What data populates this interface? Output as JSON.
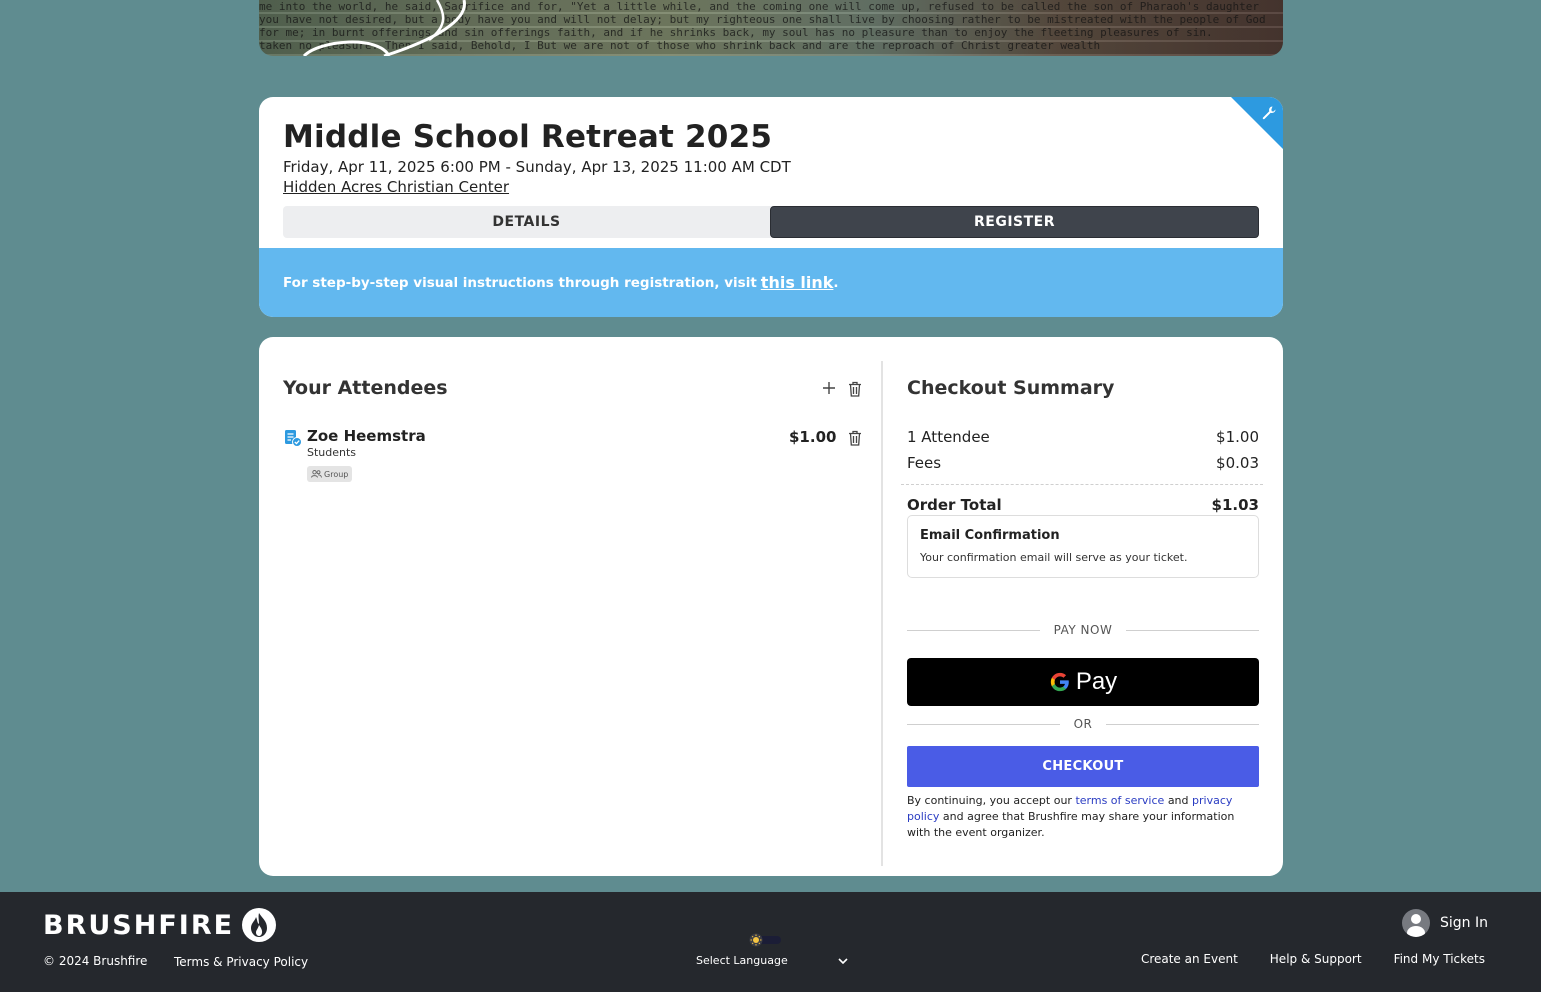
{
  "banner": {
    "lines": [
      "me into the world, he said, Sacrifice and for, \"Yet a little while, and the coming one will come  up, refused to be called the son of Pharaoh's daughter",
      " you have not desired, but a body have you   and will not delay; but my righteous one shall live by  choosing rather to be mistreated with the people of God",
      "for me; in burnt offerings and sin offerings  faith, and if he shrinks back, my soul has no pleasure  than to enjoy the fleeting pleasures of sin.",
      "taken no pleasure. Then I said, Behold, I  But we are not of those who shrink back and are  the reproach of Christ greater wealth"
    ]
  },
  "event": {
    "title": "Middle School Retreat 2025",
    "dates": "Friday, Apr 11, 2025 6:00 PM - Sunday, Apr 13, 2025 11:00 AM CDT",
    "venue": "Hidden Acres Christian Center",
    "tabs": [
      {
        "label": "DETAILS",
        "active": false
      },
      {
        "label": "REGISTER",
        "active": true
      }
    ],
    "info_text": "For step-by-step visual instructions through registration, visit",
    "info_link": "this link",
    "info_suffix": "."
  },
  "attendees": {
    "heading": "Your Attendees",
    "items": [
      {
        "name": "Zoe Heemstra",
        "type": "Students",
        "badge": "Group",
        "price": "$1.00"
      }
    ]
  },
  "summary": {
    "heading": "Checkout Summary",
    "rows": [
      {
        "label": "1 Attendee",
        "value": "$1.00"
      },
      {
        "label": "Fees",
        "value": "$0.03"
      }
    ],
    "total_label": "Order Total",
    "total_value": "$1.03",
    "email_title": "Email Confirmation",
    "email_text": "Your confirmation email will serve as your ticket.",
    "pay_now": "PAY NOW",
    "gpay_label": "Pay",
    "or": "OR",
    "checkout": "CHECKOUT",
    "legal_1": "By continuing, you accept our",
    "terms_link": "terms of service",
    "legal_and": "and",
    "privacy_link": "privacy policy",
    "legal_2": "and agree that Brushfire may share your information with the event organizer."
  },
  "footer": {
    "brand": "BRUSHFIRE",
    "copyright": "© 2024 Brushfire",
    "terms": "Terms & Privacy Policy",
    "language": "Select Language",
    "signin": "Sign In",
    "links": [
      "Create an Event",
      "Help & Support",
      "Find My Tickets"
    ]
  },
  "colors": {
    "page_bg": "#5f8c90",
    "info_bar": "#62b8ef",
    "active_tab": "#3f444c",
    "checkout_button": "#4a5ce6",
    "footer_bg": "#25282d",
    "corner_ribbon": "#2d9ae0"
  },
  "icons": [
    "wrench-icon",
    "plus-icon",
    "trash-icon",
    "attendee-form-icon",
    "group-icon",
    "google-g-icon",
    "brushfire-flame-icon",
    "sun-icon",
    "chevron-down-icon",
    "user-avatar-icon"
  ]
}
